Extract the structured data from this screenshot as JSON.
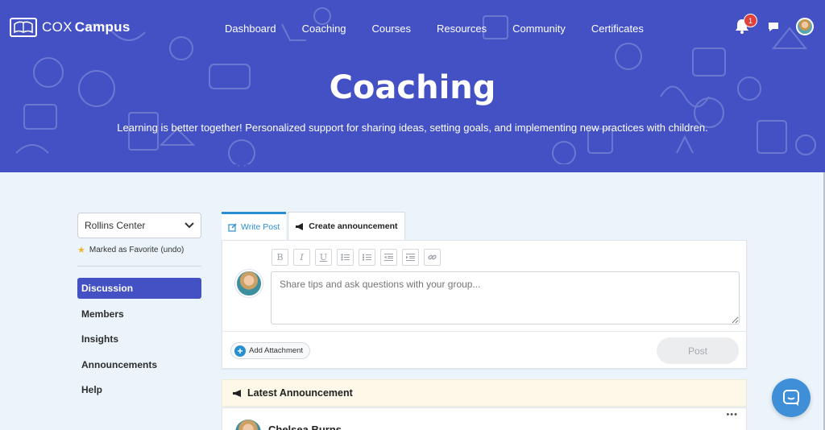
{
  "brand": {
    "name_light": "COX",
    "name_bold": "Campus"
  },
  "nav": {
    "items": [
      {
        "label": "Dashboard"
      },
      {
        "label": "Coaching"
      },
      {
        "label": "Courses"
      },
      {
        "label": "Resources"
      },
      {
        "label": "Community"
      },
      {
        "label": "Certificates"
      }
    ]
  },
  "header_icons": {
    "notification_count": "1",
    "icons": [
      "bell-icon",
      "chat-icon",
      "user-avatar"
    ]
  },
  "hero": {
    "title": "Coaching",
    "subtitle": "Learning is better together! Personalized support for sharing ideas, setting goals, and implementing new practices with children."
  },
  "sidebar": {
    "group_select": "Rollins Center",
    "favorite": {
      "text": "Marked as Favorite",
      "undo": "(undo)"
    },
    "items": [
      {
        "label": "Discussion",
        "active": true
      },
      {
        "label": "Members"
      },
      {
        "label": "Insights"
      },
      {
        "label": "Announcements"
      },
      {
        "label": "Help"
      }
    ]
  },
  "composer": {
    "tabs": [
      {
        "label": "Write Post",
        "active": true
      },
      {
        "label": "Create announcement"
      }
    ],
    "toolbar": {
      "bold": "B",
      "italic": "I",
      "underline": "U"
    },
    "placeholder": "Share tips and ask questions with your group...",
    "attach_label": "Add Attachment",
    "post_label": "Post"
  },
  "announcement": {
    "heading": "Latest Announcement",
    "author": "Chelsea Burns",
    "menu": "•••"
  },
  "colors": {
    "brand": "#4351c4",
    "accent": "#2a8fd2",
    "badge": "#e0413c",
    "background": "#eaf4fa"
  }
}
